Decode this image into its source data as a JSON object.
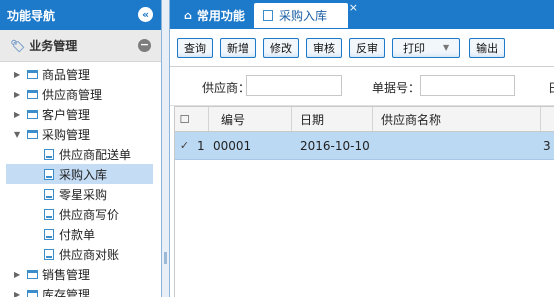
{
  "nav": {
    "title": "功能导航",
    "collapse_glyph": "«",
    "section": "业务管理",
    "minus_glyph": "−",
    "items": [
      {
        "label": "商品管理",
        "expanded": false
      },
      {
        "label": "供应商管理",
        "expanded": false
      },
      {
        "label": "客户管理",
        "expanded": false
      },
      {
        "label": "采购管理",
        "expanded": true
      },
      {
        "label": "销售管理",
        "expanded": false
      },
      {
        "label": "库存管理",
        "expanded": false
      }
    ],
    "children": [
      {
        "label": "供应商配送单"
      },
      {
        "label": "采购入库",
        "selected": true
      },
      {
        "label": "零星采购"
      },
      {
        "label": "供应商写价"
      },
      {
        "label": "付款单"
      },
      {
        "label": "供应商对账"
      }
    ]
  },
  "tabs": {
    "home": "常用功能",
    "active": "采购入库",
    "close_glyph": "×"
  },
  "toolbar": {
    "query": "查询",
    "add": "新增",
    "modify": "修改",
    "audit": "审核",
    "unaudit": "反审",
    "print": "打印",
    "export": "输出"
  },
  "search": {
    "supplier_label": "供应商：",
    "supplier_value": "",
    "doc_no_label": "单据号：",
    "doc_no_value": "",
    "next_label_fragment": "日"
  },
  "grid": {
    "columns": [
      "编号",
      "日期",
      "供应商名称"
    ],
    "rows": [
      {
        "row_no": "1",
        "checked": true,
        "cells": [
          "00001",
          "2016-10-10",
          ""
        ]
      }
    ],
    "edge_fragment": "3"
  },
  "colors": {
    "brand": "#1d79c9",
    "selected_row": "#bcd9f3",
    "selected_nav": "#c4dcf4"
  }
}
